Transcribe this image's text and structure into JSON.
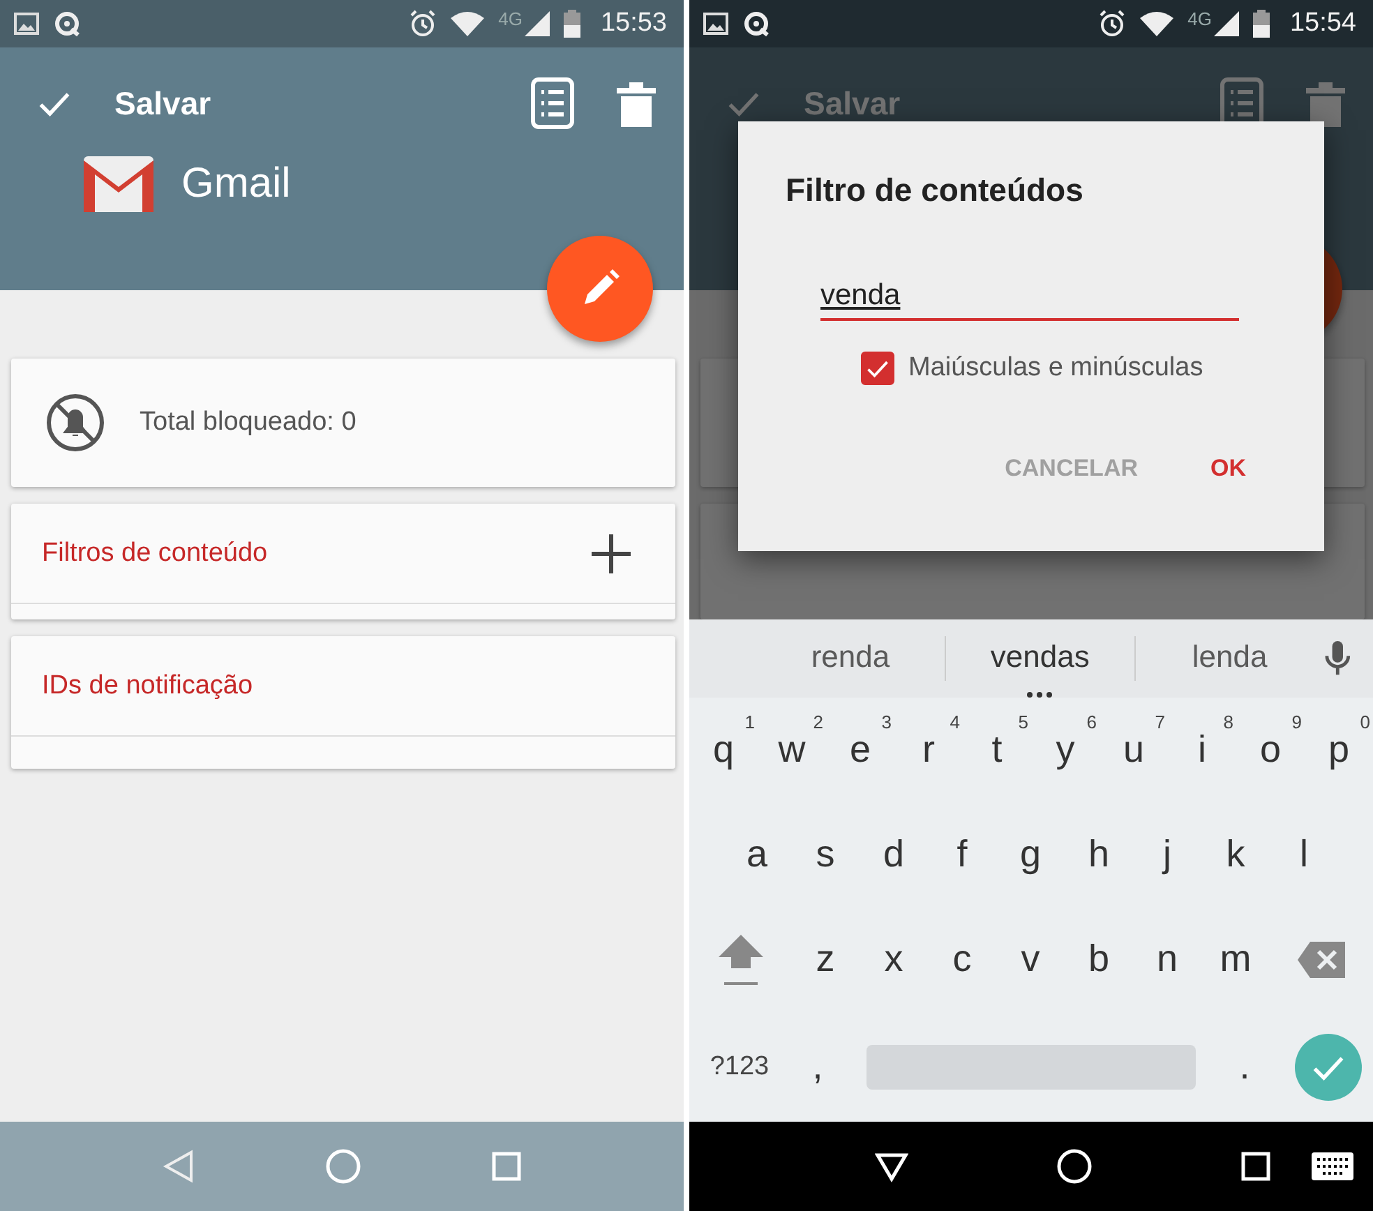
{
  "left_screen": {
    "status_bar": {
      "network": "4G",
      "time": "15:53"
    },
    "app_bar": {
      "action": "Salvar",
      "app_name": "Gmail"
    },
    "cards": [
      {
        "kind": "stat",
        "text": "Total bloqueado: 0"
      },
      {
        "kind": "section",
        "title": "Filtros de conteúdo",
        "add": true
      },
      {
        "kind": "section",
        "title": "IDs de notificação",
        "add": false
      }
    ]
  },
  "right_screen": {
    "status_bar": {
      "network": "4G",
      "time": "15:54"
    },
    "background": {
      "action": "Salvar"
    },
    "dialog": {
      "title": "Filtro de conteúdos",
      "value": "venda",
      "checkbox": {
        "label": "Maiúsculas e minúsculas",
        "checked": true
      },
      "buttons": [
        {
          "label": "CANCELAR",
          "primary": false
        },
        {
          "label": "OK",
          "primary": true
        }
      ]
    },
    "keyboard": {
      "suggestions": [
        {
          "text": "renda",
          "selected": false
        },
        {
          "text": "vendas",
          "selected": true
        },
        {
          "text": "lenda",
          "selected": false
        }
      ],
      "rows": [
        [
          {
            "key": "q",
            "hint": "1"
          },
          {
            "key": "w",
            "hint": "2"
          },
          {
            "key": "e",
            "hint": "3"
          },
          {
            "key": "r",
            "hint": "4"
          },
          {
            "key": "t",
            "hint": "5"
          },
          {
            "key": "y",
            "hint": "6"
          },
          {
            "key": "u",
            "hint": "7"
          },
          {
            "key": "i",
            "hint": "8"
          },
          {
            "key": "o",
            "hint": "9"
          },
          {
            "key": "p",
            "hint": "0"
          }
        ],
        [
          {
            "key": "a"
          },
          {
            "key": "s"
          },
          {
            "key": "d"
          },
          {
            "key": "f"
          },
          {
            "key": "g"
          },
          {
            "key": "h"
          },
          {
            "key": "j"
          },
          {
            "key": "k"
          },
          {
            "key": "l"
          }
        ],
        [
          {
            "key": "z"
          },
          {
            "key": "x"
          },
          {
            "key": "c"
          },
          {
            "key": "v"
          },
          {
            "key": "b"
          },
          {
            "key": "n"
          },
          {
            "key": "m"
          }
        ]
      ],
      "symbols_key": "?123",
      "comma_key": ",",
      "period_key": "."
    }
  }
}
